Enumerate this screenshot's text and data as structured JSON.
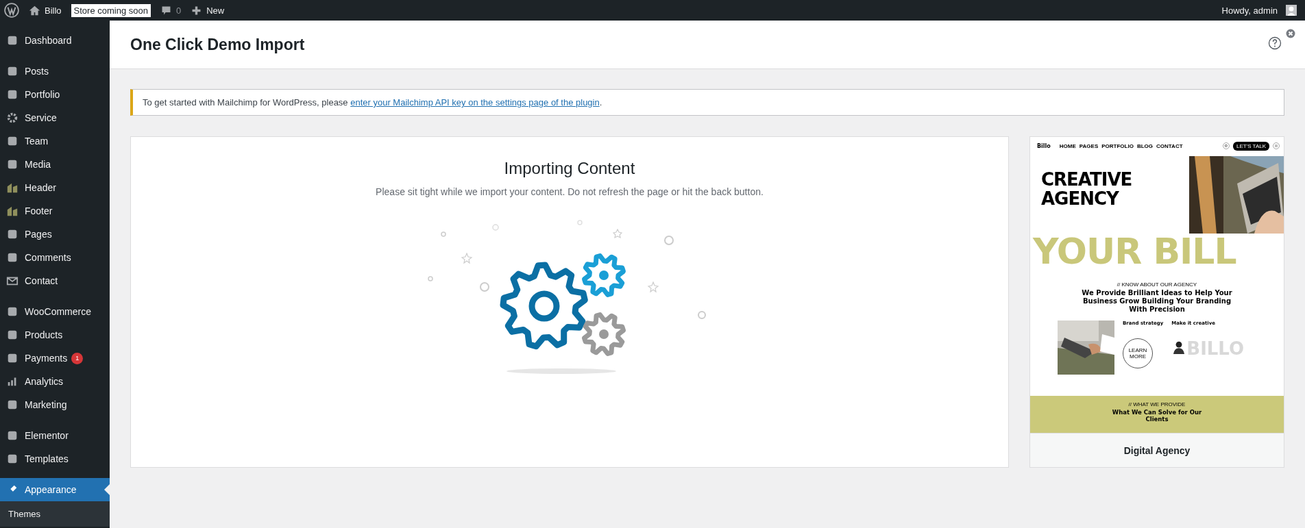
{
  "admin_bar": {
    "site": "Billo",
    "badge": "Store coming soon",
    "comments": "0",
    "new": "New",
    "greeting": "Howdy, admin"
  },
  "sidebar": {
    "items": [
      {
        "label": "Dashboard",
        "selected": false,
        "gap_before": false
      },
      {
        "label": "Posts",
        "selected": false,
        "gap_before": true
      },
      {
        "label": "Portfolio",
        "selected": false,
        "gap_before": false
      },
      {
        "label": "Service",
        "selected": false,
        "gap_before": false
      },
      {
        "label": "Team",
        "selected": false,
        "gap_before": false
      },
      {
        "label": "Media",
        "selected": false,
        "gap_before": false
      },
      {
        "label": "Header",
        "selected": false,
        "gap_before": false
      },
      {
        "label": "Footer",
        "selected": false,
        "gap_before": false
      },
      {
        "label": "Pages",
        "selected": false,
        "gap_before": false
      },
      {
        "label": "Comments",
        "selected": false,
        "gap_before": false
      },
      {
        "label": "Contact",
        "selected": false,
        "gap_before": false
      },
      {
        "label": "WooCommerce",
        "selected": false,
        "gap_before": true
      },
      {
        "label": "Products",
        "selected": false,
        "gap_before": false
      },
      {
        "label": "Payments",
        "selected": false,
        "gap_before": false,
        "badge": "1"
      },
      {
        "label": "Analytics",
        "selected": false,
        "gap_before": false
      },
      {
        "label": "Marketing",
        "selected": false,
        "gap_before": false
      },
      {
        "label": "Elementor",
        "selected": false,
        "gap_before": true
      },
      {
        "label": "Templates",
        "selected": false,
        "gap_before": false
      },
      {
        "label": "Appearance",
        "selected": true,
        "gap_before": true
      }
    ],
    "submenu": [
      {
        "label": "Themes"
      }
    ]
  },
  "page": {
    "title": "One Click Demo Import"
  },
  "notice": {
    "text": "To get started with Mailchimp for WordPress, please ",
    "link": "enter your Mailchimp API key on the settings page of the plugin",
    "end": "."
  },
  "import": {
    "title": "Importing Content",
    "message": "Please sit tight while we import your content. Do not refresh the page or hit the back button."
  },
  "preview": {
    "logo": "Billo",
    "nav": [
      "HOME",
      "PAGES",
      "PORTFOLIO",
      "BLOG",
      "CONTACT"
    ],
    "cta": "LET'S TALK",
    "hero": [
      "CREATIVE",
      "AGENCY"
    ],
    "marquee": "YOUR BILL",
    "kicker": "// KNOW ABOUT OUR AGENCY",
    "heading": "We Provide Brilliant Ideas to Help Your Business Grow Building Your Branding With Precision",
    "features": [
      "Brand strategy",
      "Make it creative"
    ],
    "learn_more": "LEARN MORE",
    "watermark": "BILLO",
    "band_kicker": "// WHAT WE PROVIDE",
    "band_heading": "What We Can Solve for Our Clients",
    "label": "Digital Agency"
  }
}
